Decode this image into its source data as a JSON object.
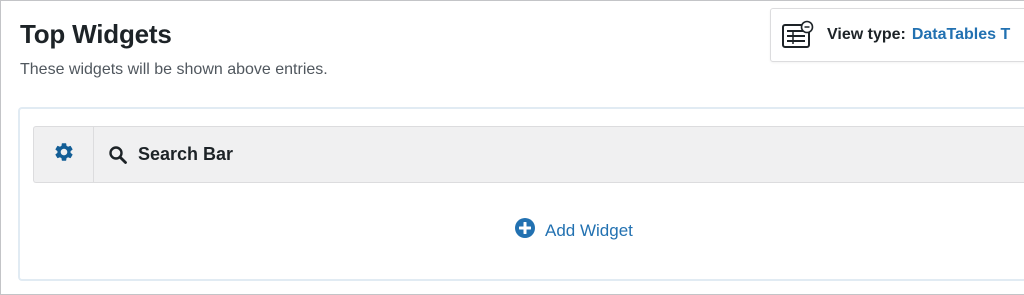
{
  "section": {
    "title": "Top Widgets",
    "description": "These widgets will be shown above entries."
  },
  "view_type": {
    "label": "View type:",
    "value": "DataTables T",
    "icon": "table-view-icon"
  },
  "widgets": [
    {
      "name": "Search Bar",
      "icon": "search-icon",
      "settings_icon": "gear-icon"
    }
  ],
  "add_widget": {
    "label": "Add Widget",
    "icon": "plus-circle-icon"
  },
  "colors": {
    "accent": "#2271b1",
    "settings_icon": "#135e96",
    "text": "#1d2327",
    "muted": "#50575e",
    "row_bg": "#f0f0f1",
    "area_border": "#e1ebf3"
  }
}
